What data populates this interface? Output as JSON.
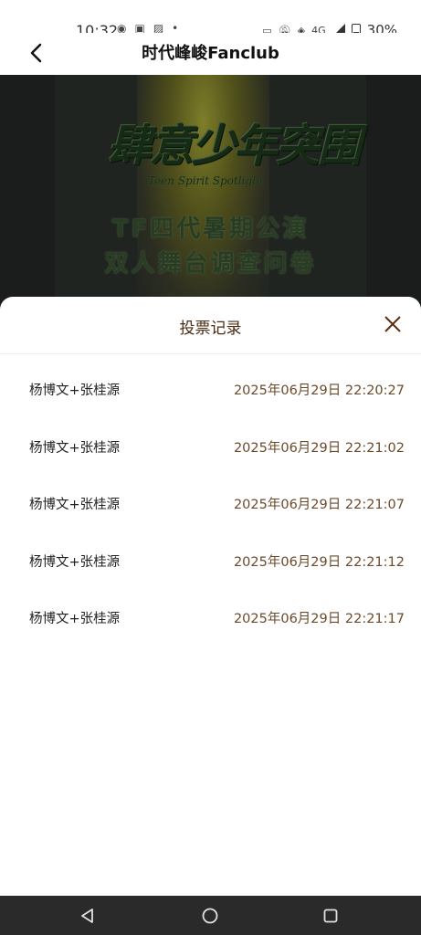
{
  "status_bar": {
    "time": "10:32",
    "network": "4G",
    "battery": "30%"
  },
  "header": {
    "title": "时代峰峻Fanclub"
  },
  "banner": {
    "logo_text": "肆意少年突围",
    "logo_sub": "Teen Spirit Spotlight",
    "line1": "TF四代暑期公演",
    "line2": "双人舞台调查问卷"
  },
  "sheet": {
    "title": "投票记录",
    "records": [
      {
        "name": "杨博文+张桂源",
        "time": "2025年06月29日 22:20:27"
      },
      {
        "name": "杨博文+张桂源",
        "time": "2025年06月29日 22:21:02"
      },
      {
        "name": "杨博文+张桂源",
        "time": "2025年06月29日 22:21:07"
      },
      {
        "name": "杨博文+张桂源",
        "time": "2025年06月29日 22:21:12"
      },
      {
        "name": "杨博文+张桂源",
        "time": "2025年06月29日 22:21:17"
      }
    ]
  },
  "colors": {
    "sheet_title": "#4a2a12",
    "timestamp": "#6b4a2a",
    "close_icon": "#5a3010",
    "nav_bar": "#2a2a2a"
  }
}
